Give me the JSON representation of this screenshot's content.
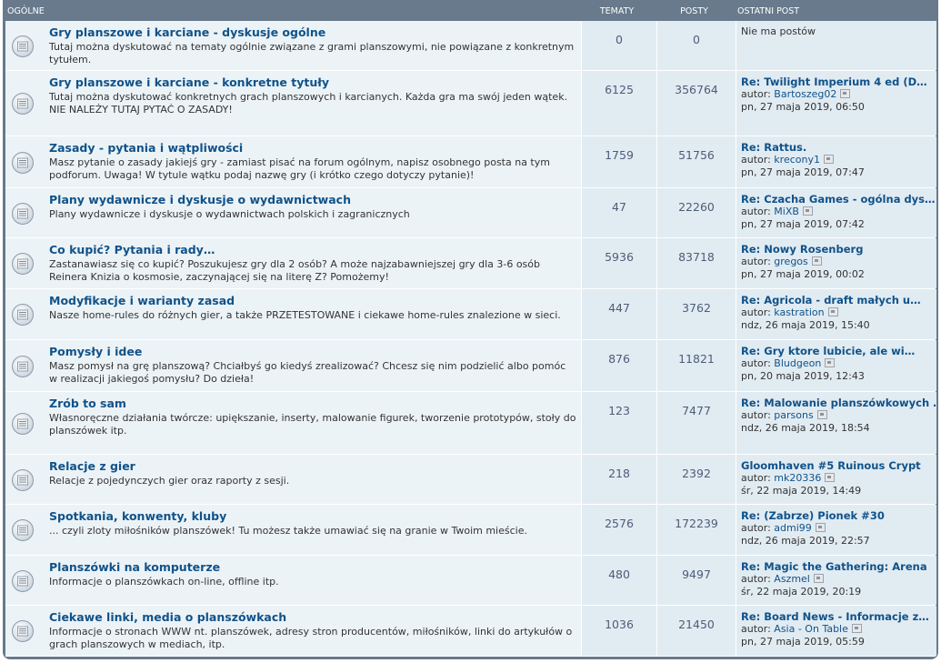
{
  "header": {
    "forum": "OGÓLNE",
    "topics": "TEMATY",
    "posts": "POSTY",
    "last_post": "OSTATNI POST"
  },
  "icon": "forum-read-icon",
  "colors": {
    "header_bg": "#687a8c",
    "row_bg": "#ecf3f7",
    "stat_bg": "#e1ebf2",
    "link": "#105289"
  },
  "forums": [
    {
      "title": "Gry planszowe i karciane - dyskusje ogólne",
      "desc": "Tutaj można dyskutować na tematy ogólnie związane z grami planszowymi, nie powiązane z konkretnym tytułem.",
      "topics": "0",
      "posts": "0",
      "last_title": "",
      "last_by": "",
      "last_user": "",
      "last_date": "",
      "empty_text": "Nie ma postów"
    },
    {
      "title": "Gry planszowe i karciane - konkretne tytuły",
      "desc": "Tutaj można dyskutować konkretnych grach planszowych i karcianych. Każda gra ma swój jeden wątek.",
      "desc2": "NIE NALEŻY TUTAJ PYTAĆ O ZASADY!",
      "topics": "6125",
      "posts": "356764",
      "last_title": "Re: Twilight Imperium 4 ed (D…",
      "last_by": "autor:",
      "last_user": "Bartoszeg02",
      "last_date": "pn, 27 maja 2019, 06:50"
    },
    {
      "title": "Zasady - pytania i wątpliwości",
      "desc": "Masz pytanie o zasady jakiejś gry - zamiast pisać na forum ogólnym, napisz osobnego posta na tym podforum. Uwaga! W tytule wątku podaj nazwę gry (i krótko czego dotyczy pytanie)!",
      "topics": "1759",
      "posts": "51756",
      "last_title": "Re: Rattus.",
      "last_by": "autor:",
      "last_user": "krecony1",
      "last_date": "pn, 27 maja 2019, 07:47"
    },
    {
      "title": "Plany wydawnicze i dyskusje o wydawnictwach",
      "desc": "Plany wydawnicze i dyskusje o wydawnictwach polskich i zagranicznych",
      "topics": "47",
      "posts": "22260",
      "last_title": "Re: Czacha Games - ogólna dys…",
      "last_by": "autor:",
      "last_user": "MiXB",
      "last_date": "pn, 27 maja 2019, 07:42"
    },
    {
      "title": "Co kupić? Pytania i rady…",
      "desc": "Zastanawiasz się co kupić? Poszukujesz gry dla 2 osób? A może najzabawniejszej gry dla 3-6 osób Reinera Knizia o kosmosie, zaczynającej się na literę Z? Pomożemy!",
      "topics": "5936",
      "posts": "83718",
      "last_title": "Re: Nowy Rosenberg",
      "last_by": "autor:",
      "last_user": "gregos",
      "last_date": "pn, 27 maja 2019, 00:02"
    },
    {
      "title": "Modyfikacje i warianty zasad",
      "desc": "Nasze home-rules do różnych gier, a także PRZETESTOWANE i ciekawe home-rules znalezione w sieci.",
      "topics": "447",
      "posts": "3762",
      "last_title": "Re: Agricola - draft małych u…",
      "last_by": "autor:",
      "last_user": "kastration",
      "last_date": "ndz, 26 maja 2019, 15:40"
    },
    {
      "title": "Pomysły i idee",
      "desc": "Masz pomysł na grę planszową? Chciałbyś go kiedyś zrealizować? Chcesz się nim podzielić albo pomóc w realizacji jakiegoś pomysłu? Do dzieła!",
      "topics": "876",
      "posts": "11821",
      "last_title": "Re: Gry ktore lubicie, ale wi…",
      "last_by": "autor:",
      "last_user": "Bludgeon",
      "last_date": "pn, 20 maja 2019, 12:43"
    },
    {
      "title": "Zrób to sam",
      "desc": "Własnoręczne działania twórcze: upiększanie, inserty, malowanie figurek, tworzenie prototypów, stoły do planszówek itp.",
      "topics": "123",
      "posts": "7477",
      "last_title": "Re: Malowanie planszówkowych …",
      "last_by": "autor:",
      "last_user": "parsons",
      "last_date": "ndz, 26 maja 2019, 18:54"
    },
    {
      "title": "Relacje z gier",
      "desc": "Relacje z pojedynczych gier oraz raporty z sesji.",
      "topics": "218",
      "posts": "2392",
      "last_title": "Gloomhaven #5 Ruinous Crypt",
      "last_by": "autor:",
      "last_user": "mk20336",
      "last_date": "śr, 22 maja 2019, 14:49"
    },
    {
      "title": "Spotkania, konwenty, kluby",
      "desc": "... czyli zloty miłośników planszówek! Tu możesz także umawiać się na granie w Twoim mieście.",
      "topics": "2576",
      "posts": "172239",
      "last_title": "Re: (Zabrze) Pionek #30",
      "last_by": "autor:",
      "last_user": "admi99",
      "last_date": "ndz, 26 maja 2019, 22:57"
    },
    {
      "title": "Planszówki na komputerze",
      "desc": "Informacje o planszówkach on-line, offline itp.",
      "topics": "480",
      "posts": "9497",
      "last_title": "Re: Magic the Gathering: Arena",
      "last_by": "autor:",
      "last_user": "Aszmel",
      "last_date": "śr, 22 maja 2019, 20:19"
    },
    {
      "title": "Ciekawe linki, media o planszówkach",
      "desc": "Informacje o stronach WWW nt. planszówek, adresy stron producentów, miłośników, linki do artykułów o grach planszowych w mediach, itp.",
      "topics": "1036",
      "posts": "21450",
      "last_title": "Re: Board News - Informacje z…",
      "last_by": "autor:",
      "last_user": "Asia - On Table",
      "last_date": "pn, 27 maja 2019, 05:59"
    }
  ]
}
